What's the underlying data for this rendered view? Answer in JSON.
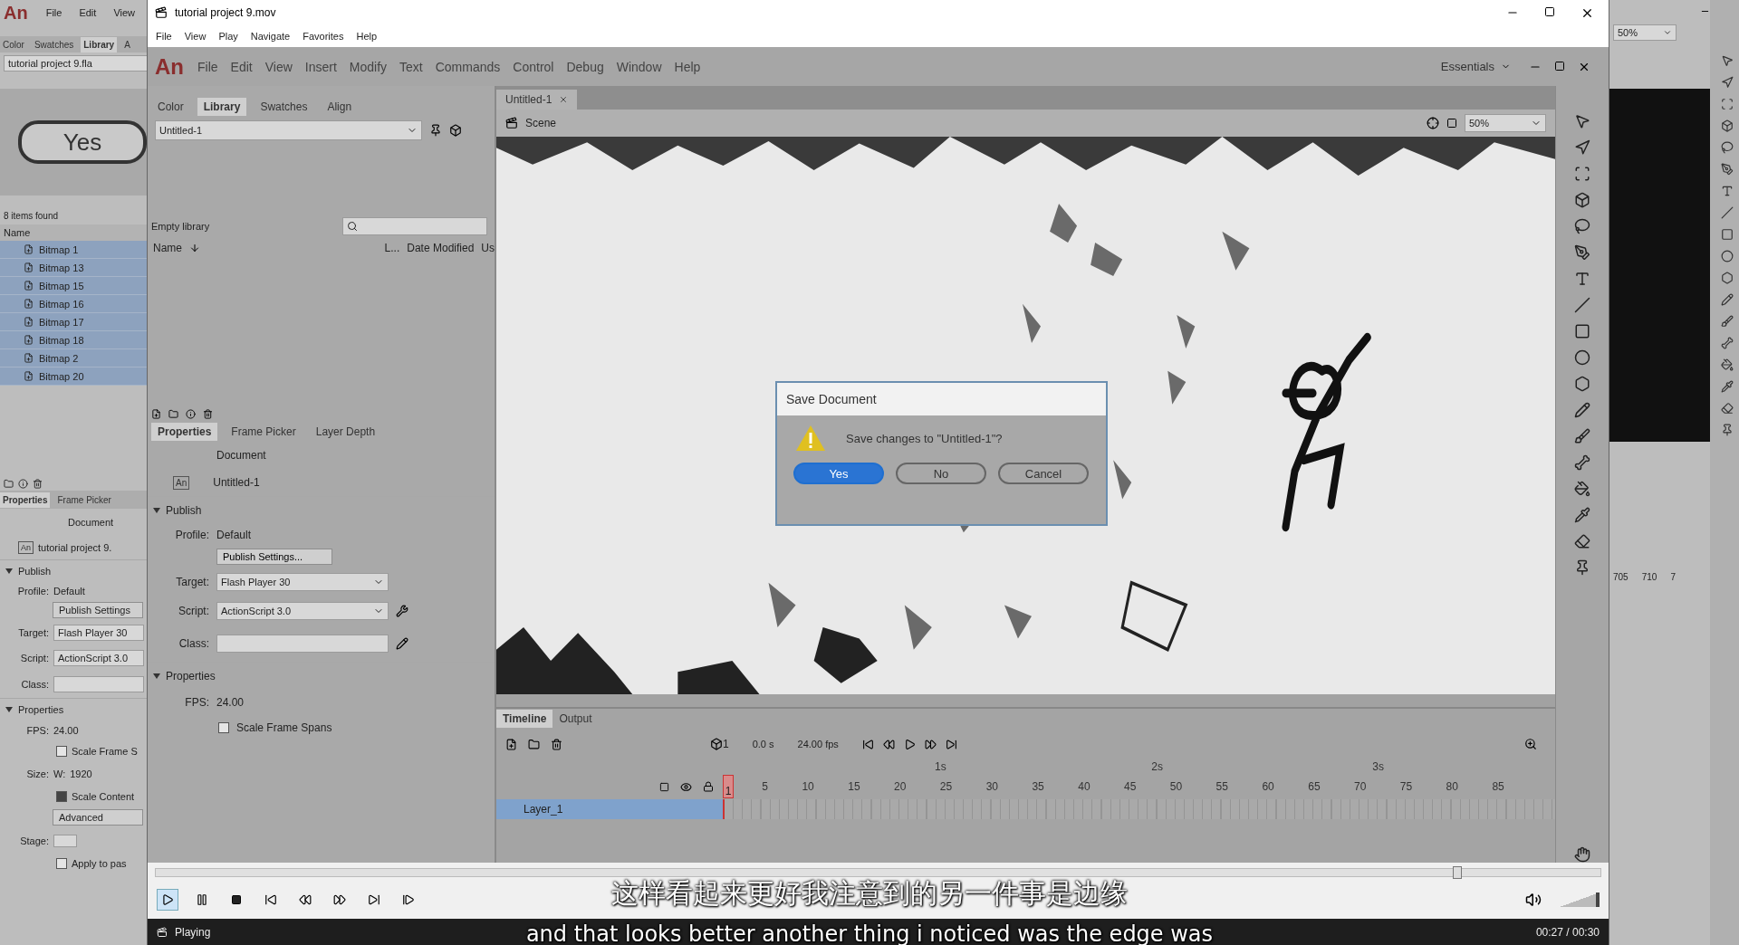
{
  "background_app": {
    "logo": "An",
    "menu": [
      "File",
      "Edit",
      "View"
    ],
    "panel_tabs": [
      {
        "label": "Color",
        "selected": false
      },
      {
        "label": "Swatches",
        "selected": false
      },
      {
        "label": "Library",
        "selected": true
      },
      {
        "label": "A",
        "selected": false
      }
    ],
    "library_file": "tutorial project 9.fla",
    "preview_label": "Yes",
    "items_found": "8 items found",
    "column_name": "Name",
    "items": [
      {
        "label": "Bitmap 1",
        "selected": true
      },
      {
        "label": "Bitmap 13",
        "selected": true
      },
      {
        "label": "Bitmap 15",
        "selected": true
      },
      {
        "label": "Bitmap 16",
        "selected": true
      },
      {
        "label": "Bitmap 17",
        "selected": true
      },
      {
        "label": "Bitmap 18",
        "selected": true
      },
      {
        "label": "Bitmap 2",
        "selected": true
      },
      {
        "label": "Bitmap 20",
        "selected": true
      }
    ],
    "props_tabs": [
      {
        "label": "Properties",
        "selected": true
      },
      {
        "label": "Frame Picker",
        "selected": false
      }
    ],
    "doc_type": "Document",
    "app_badge": "An",
    "doc_name": "tutorial project 9.",
    "publish_header": "Publish",
    "profile_label": "Profile:",
    "profile_value": "Default",
    "publish_settings": "Publish Settings",
    "target_label": "Target:",
    "target_value": "Flash Player 30",
    "script_label": "Script:",
    "script_value": "ActionScript 3.0",
    "class_label": "Class:",
    "properties_header": "Properties",
    "fps_label": "FPS:",
    "fps_value": "24.00",
    "scale_frame": {
      "label": "Scale Frame S",
      "checked": false
    },
    "size_label": "Size:",
    "width_label": "W:",
    "width_value": "1920",
    "scale_content": {
      "label": "Scale Content",
      "checked": true
    },
    "advanced": "Advanced",
    "stage_label": "Stage:",
    "apply": {
      "label": "Apply to pas",
      "checked": false
    }
  },
  "background_right": {
    "zoom": "50%",
    "ruler": [
      "705",
      "710",
      "7"
    ]
  },
  "player": {
    "title": "tutorial project 9.mov",
    "menu": [
      "File",
      "View",
      "Play",
      "Navigate",
      "Favorites",
      "Help"
    ],
    "seek": {
      "level": 0.9
    },
    "volume": {
      "level": 1
    },
    "status": "Playing",
    "time": "00:27 / 00:30"
  },
  "recording": {
    "logo": "An",
    "menu": [
      "File",
      "Edit",
      "View",
      "Insert",
      "Modify",
      "Text",
      "Commands",
      "Control",
      "Debug",
      "Window",
      "Help"
    ],
    "workspace": "Essentials",
    "library_tabs": [
      {
        "label": "Color",
        "selected": false
      },
      {
        "label": "Library",
        "selected": true
      },
      {
        "label": "Swatches",
        "selected": false
      },
      {
        "label": "Align",
        "selected": false
      }
    ],
    "library_doc": "Untitled-1",
    "library_status": "Empty library",
    "columns": [
      "Name",
      "L...",
      "Date Modified",
      "Us"
    ],
    "props_tabs": [
      {
        "label": "Properties",
        "selected": true
      },
      {
        "label": "Frame Picker",
        "selected": false
      },
      {
        "label": "Layer Depth",
        "selected": false
      }
    ],
    "doc_type": "Document",
    "app_badge": "An",
    "doc_name": "Untitled-1",
    "publish_header": "Publish",
    "profile_label": "Profile:",
    "profile_value": "Default",
    "publish_settings": "Publish Settings...",
    "target_label": "Target:",
    "target_value": "Flash Player 30",
    "script_label": "Script:",
    "script_value": "ActionScript 3.0",
    "class_label": "Class:",
    "properties_header": "Properties",
    "fps_label": "FPS:",
    "fps_value": "24.00",
    "scale_frame": {
      "label": "Scale Frame Spans",
      "checked": false
    },
    "doc_tab": "Untitled-1",
    "scene": "Scene",
    "zoom": "50%",
    "dialog": {
      "title": "Save Document",
      "message": "Save changes to \"Untitled-1\"?",
      "buttons": [
        {
          "label": "Yes",
          "selected": true
        },
        {
          "label": "No",
          "selected": false
        },
        {
          "label": "Cancel",
          "selected": false
        }
      ]
    },
    "timeline": {
      "tabs": [
        {
          "label": "Timeline",
          "selected": true
        },
        {
          "label": "Output",
          "selected": false
        }
      ],
      "frame": "1",
      "time": "0.0 s",
      "fps": "24.00 fps",
      "seconds": [
        "1s",
        "2s",
        "3s"
      ],
      "frames": [
        "1",
        "5",
        "10",
        "15",
        "20",
        "25",
        "30",
        "35",
        "40",
        "45",
        "50",
        "55",
        "60",
        "65",
        "70",
        "75",
        "80",
        "85"
      ],
      "layers": [
        {
          "name": "Layer_1",
          "selected": true
        }
      ]
    }
  },
  "subtitles": {
    "chinese": "这样看起来更好我注意到的另一件事是边缘",
    "english": "and that looks better another thing i noticed was the edge was"
  }
}
